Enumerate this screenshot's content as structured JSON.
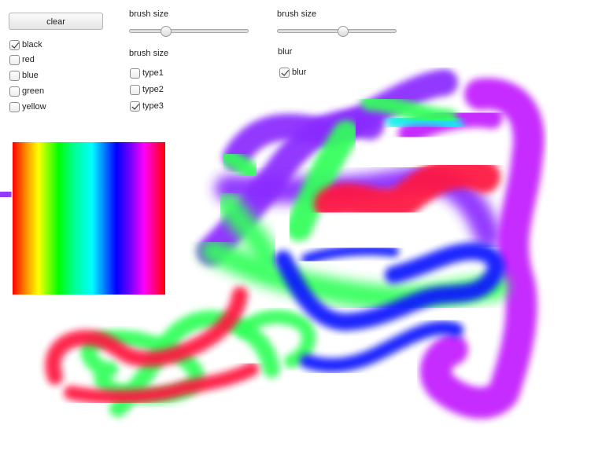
{
  "buttons": {
    "clear": "clear"
  },
  "colors_panel": {
    "items": [
      {
        "label": "black",
        "checked": true
      },
      {
        "label": "red",
        "checked": false
      },
      {
        "label": "blue",
        "checked": false
      },
      {
        "label": "green",
        "checked": false
      },
      {
        "label": "yellow",
        "checked": false
      }
    ]
  },
  "brush_panel": {
    "slider_label": "brush size",
    "slider_value_fraction": 0.29,
    "type_label": "brush size",
    "types": [
      {
        "label": "type1",
        "checked": false
      },
      {
        "label": "type2",
        "checked": false
      },
      {
        "label": "type3",
        "checked": true
      }
    ]
  },
  "blur_panel": {
    "slider_label": "brush size",
    "slider_value_fraction": 0.56,
    "blur_label": "blur",
    "blur_checkbox": {
      "label": "blur",
      "checked": true
    }
  },
  "stroke_colors": {
    "purple": "#8a2cff",
    "magenta": "#c21cff",
    "green": "#33ff5a",
    "red": "#ff1440",
    "blue": "#0a14ff",
    "cyan": "#10f0ee"
  }
}
